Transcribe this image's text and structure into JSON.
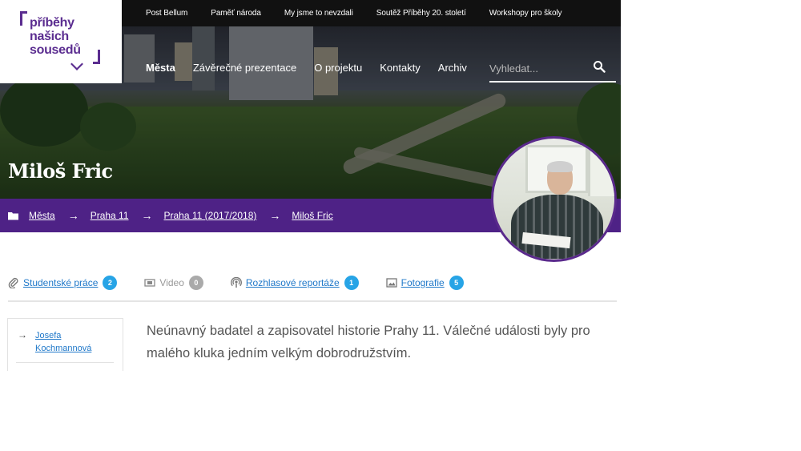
{
  "logo": {
    "lines": [
      "příběhy",
      "našich",
      "sousedů"
    ]
  },
  "topbar": {
    "links": [
      "Post Bellum",
      "Paměť národa",
      "My jsme to nevzdali",
      "Soutěž Příběhy 20. století",
      "Workshopy pro školy"
    ]
  },
  "nav": {
    "items": [
      "Města",
      "Závěrečné prezentace",
      "O projektu",
      "Kontakty",
      "Archiv"
    ],
    "active": "Města"
  },
  "search": {
    "placeholder": "Vyhledat..."
  },
  "hero": {
    "title": "Miloš Fric"
  },
  "breadcrumb": [
    "Města",
    "Praha 11",
    "Praha 11 (2017/2018)",
    "Miloš Fric"
  ],
  "tabs": [
    {
      "label": "Studentské práce",
      "count": "2",
      "icon": "paperclip-icon",
      "enabled": true
    },
    {
      "label": "Video",
      "count": "0",
      "icon": "film-icon",
      "enabled": false
    },
    {
      "label": "Rozhlasové reportáže",
      "count": "1",
      "icon": "podcast-icon",
      "enabled": true
    },
    {
      "label": "Fotografie",
      "count": "5",
      "icon": "image-icon",
      "enabled": true
    }
  ],
  "sidebar": {
    "items": [
      "Josefa Kochmannová"
    ]
  },
  "lead": "Neúnavný badatel a zapisovatel historie Prahy 11. Válečné události byly pro malého kluka jedním velkým dobrodružstvím.",
  "colors": {
    "brand": "#5b2d90",
    "breadcrumb_bg": "#4e2286",
    "badge": "#27a4e6",
    "link": "#1f78c9"
  }
}
